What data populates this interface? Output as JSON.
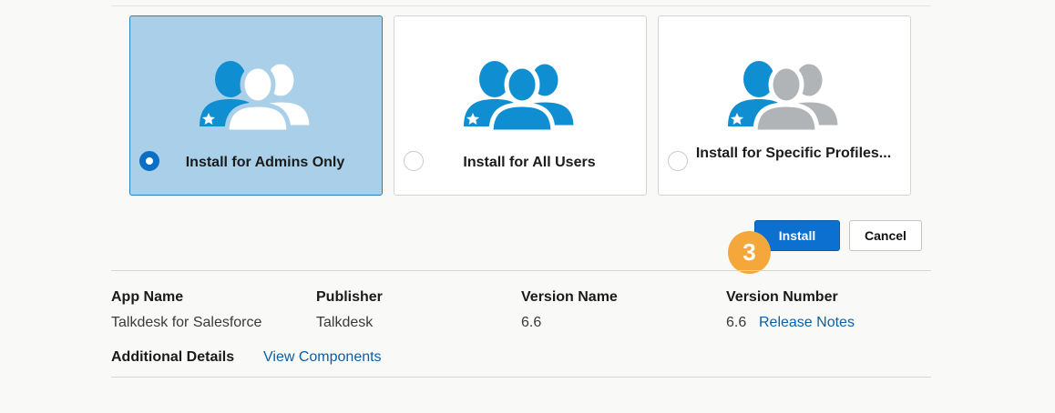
{
  "install_options": [
    {
      "label": "Install for Admins Only",
      "selected": true
    },
    {
      "label": "Install for All Users",
      "selected": false
    },
    {
      "label": "Install for Specific Profiles...",
      "selected": false
    }
  ],
  "buttons": {
    "install": "Install",
    "cancel": "Cancel"
  },
  "step_badge": "3",
  "details": {
    "app_name_label": "App Name",
    "app_name": "Talkdesk for Salesforce",
    "publisher_label": "Publisher",
    "publisher": "Talkdesk",
    "version_name_label": "Version Name",
    "version_name": "6.6",
    "version_number_label": "Version Number",
    "version_number": "6.6",
    "release_notes_link": "Release Notes",
    "additional_details_label": "Additional Details",
    "view_components_link": "View Components"
  },
  "colors": {
    "accent": "#0b70cf",
    "selected_bg": "#a9d0e8",
    "badge": "#f4a83c",
    "person_blue": "#0f8fd1",
    "person_gray": "#b1b4b6"
  },
  "icons": [
    "admins-only-illustration-icon",
    "all-users-illustration-icon",
    "specific-profiles-illustration-icon",
    "star-icon"
  ]
}
